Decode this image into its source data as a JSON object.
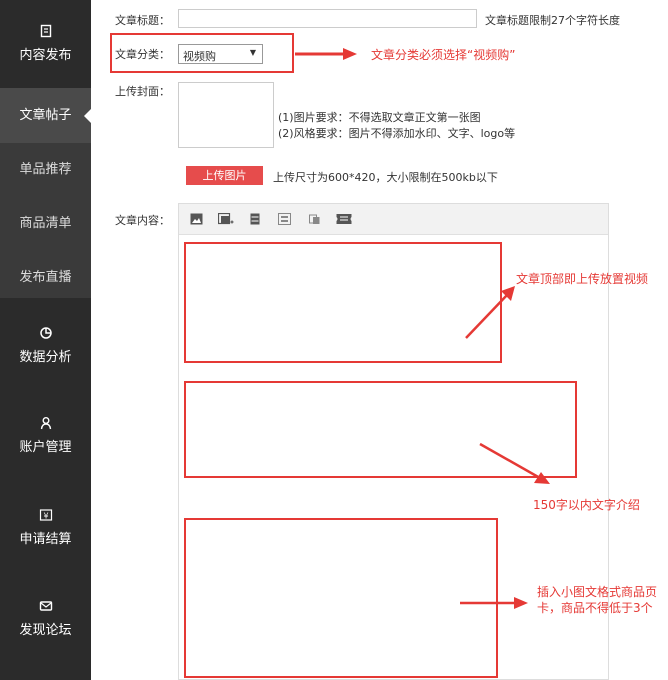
{
  "sidebar": {
    "menu": [
      {
        "label": "内容发布",
        "icon": "clipboard-icon"
      },
      {
        "label": "数据分析",
        "icon": "pie-chart-icon"
      },
      {
        "label": "账户管理",
        "icon": "user-icon"
      },
      {
        "label": "申请结算",
        "icon": "yuan-receipt-icon"
      },
      {
        "label": "发现论坛",
        "icon": "envelope-icon"
      }
    ],
    "sub_items": [
      {
        "label": "文章帖子",
        "active": true
      },
      {
        "label": "单品推荐",
        "active": false
      },
      {
        "label": "商品清单",
        "active": false
      },
      {
        "label": "发布直播",
        "active": false
      }
    ]
  },
  "form": {
    "title_label": "文章标题：",
    "title_value": "",
    "title_hint": "文章标题限制27个字符长度",
    "category_label": "文章分类：",
    "category_value": "视频购",
    "cover_label": "上传封面：",
    "cover_req_1": "(1)图片要求：不得选取文章正文第一张图",
    "cover_req_2": "(2)风格要求：图片不得添加水印、文字、logo等",
    "upload_button": "上传图片",
    "upload_hint": "上传尺寸为600*420，大小限制在500kb以下",
    "content_label": "文章内容：",
    "toolbar_icons": [
      "image-icon",
      "multi-image-icon",
      "video-icon",
      "template-icon",
      "product-card-icon",
      "ticket-icon"
    ]
  },
  "annotations": {
    "category_note": "文章分类必须选择“视频购”",
    "video_note": "文章顶部即上传放置视频",
    "text_note": "150字以内文字介绍",
    "card_note_1": "插入小图文格式商品页",
    "card_note_2": "卡，商品不得低于3个"
  },
  "colors": {
    "sidebar_bg": "#2b2b2b",
    "accent_red": "#e53935",
    "upload_button_bg": "#e64c4c"
  }
}
